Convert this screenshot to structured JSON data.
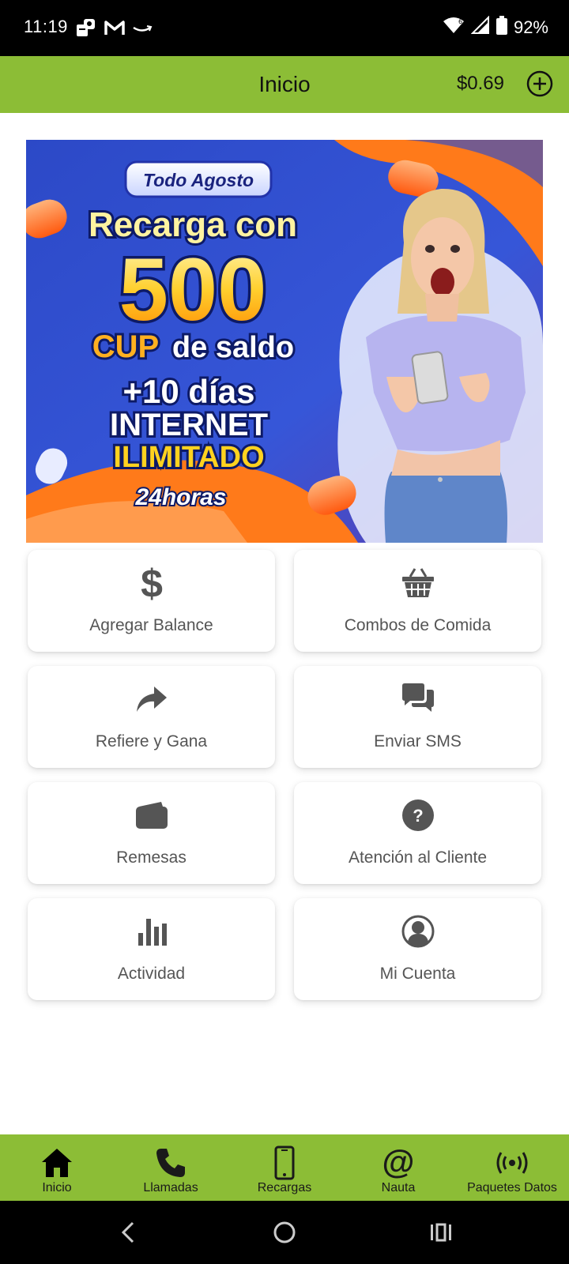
{
  "status_bar": {
    "time": "11:19",
    "battery": "92%",
    "notification_icons": [
      "app-notification-icon",
      "gmail-icon",
      "amazon-icon"
    ],
    "system_icons": [
      "wifi-icon",
      "cell-signal-icon",
      "battery-icon"
    ]
  },
  "header": {
    "title": "Inicio",
    "balance": "$0.69",
    "add_icon": "plus-circle-icon",
    "color": "#8cbd36"
  },
  "banner": {
    "badge": "Todo Agosto",
    "line1": "Recarga con",
    "amount": "500",
    "line3_currency": "CUP",
    "line3_rest": "de saldo",
    "line4": "+10 días",
    "line5": "INTERNET",
    "line6": "ILIMITADO",
    "line7": "24horas"
  },
  "tiles": [
    {
      "label": "Agregar Balance",
      "icon": "dollar-icon"
    },
    {
      "label": "Combos de Comida",
      "icon": "basket-icon"
    },
    {
      "label": "Refiere y Gana",
      "icon": "share-icon"
    },
    {
      "label": "Enviar SMS",
      "icon": "chat-icon"
    },
    {
      "label": "Remesas",
      "icon": "wallet-icon"
    },
    {
      "label": "Atención al Cliente",
      "icon": "help-icon"
    },
    {
      "label": "Actividad",
      "icon": "bar-chart-icon"
    },
    {
      "label": "Mi Cuenta",
      "icon": "user-icon"
    }
  ],
  "bottom_nav": [
    {
      "label": "Inicio",
      "icon": "home-icon",
      "active": true
    },
    {
      "label": "Llamadas",
      "icon": "phone-icon"
    },
    {
      "label": "Recargas",
      "icon": "mobile-icon"
    },
    {
      "label": "Nauta",
      "icon": "at-icon"
    },
    {
      "label": "Paquetes Datos",
      "icon": "broadcast-icon"
    }
  ],
  "system_nav": [
    "back-icon",
    "home-circle-icon",
    "recents-icon"
  ]
}
